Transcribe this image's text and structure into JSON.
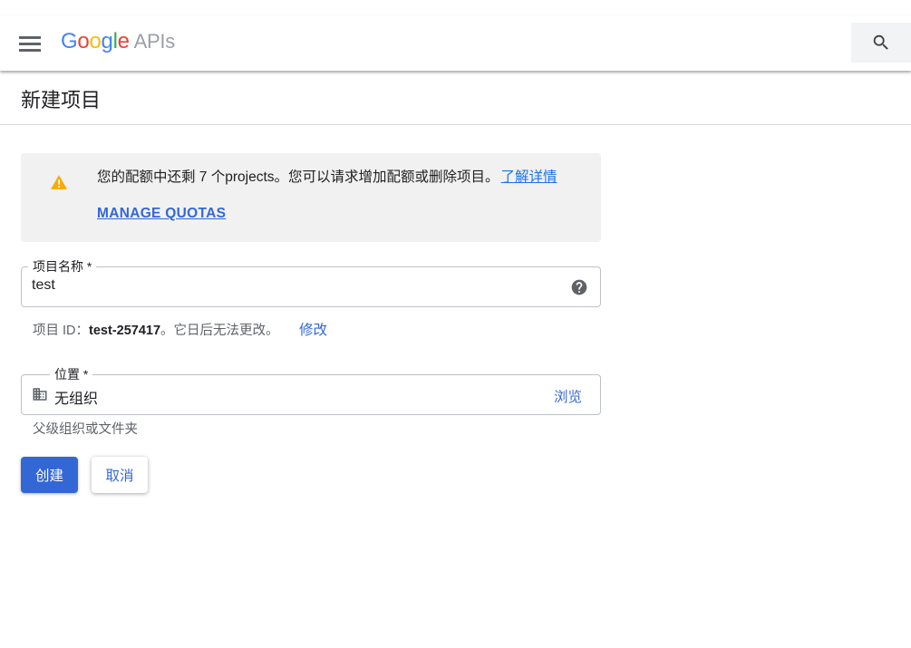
{
  "header": {
    "logo": {
      "letters": [
        "G",
        "o",
        "o",
        "g",
        "l",
        "e"
      ],
      "suffix": "APIs"
    },
    "icons": {
      "menu": "menu-icon",
      "search": "search-icon"
    }
  },
  "page": {
    "title": "新建项目"
  },
  "quota_notice": {
    "message": "您的配额中还剩 7 个projects。您可以请求增加配额或删除项目。",
    "learn_more": "了解详情",
    "manage_label": "MANAGE QUOTAS",
    "icon": "warning-icon"
  },
  "project_name": {
    "label": "项目名称 *",
    "value": "test",
    "help_icon": "help-icon"
  },
  "project_id": {
    "prefix": "项目 ID：",
    "value": "test-257417",
    "suffix": "。它日后无法更改。",
    "edit_label": "修改"
  },
  "location": {
    "label": "位置 *",
    "value": "无组织",
    "browse_label": "浏览",
    "helper": "父级组织或文件夹",
    "icon": "building-icon"
  },
  "actions": {
    "create_label": "创建",
    "cancel_label": "取消"
  },
  "colors": {
    "primary": "#3367d6",
    "warning": "#f9ab00",
    "google_blue": "#4285f4",
    "google_red": "#ea4335",
    "google_yellow": "#fbbc05",
    "google_green": "#34a853",
    "notice_bg": "#f1f1f1"
  }
}
